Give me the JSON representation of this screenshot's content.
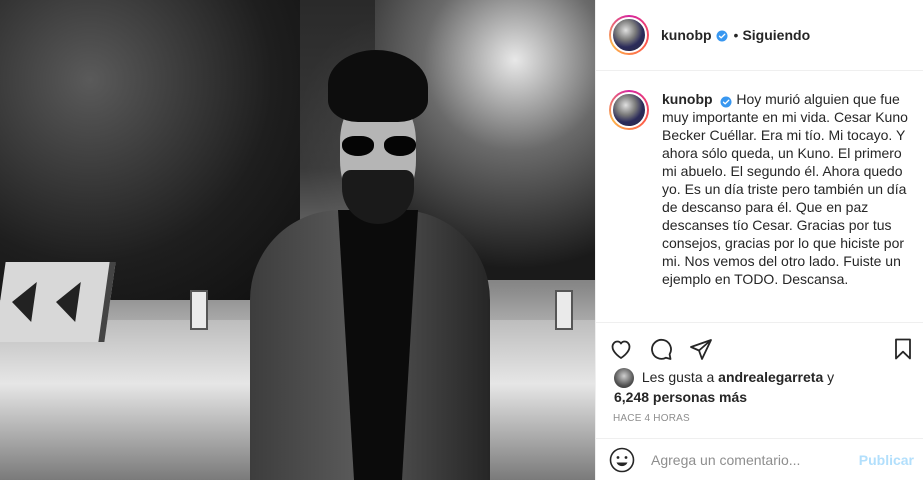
{
  "post": {
    "username": "kunobp",
    "follow_status": "Siguiendo",
    "dot": "•",
    "caption": "Hoy murió alguien que fue muy importante en mi vida. Cesar Kuno Becker Cuéllar. Era mi tío. Mi tocayo. Y ahora sólo queda, un Kuno. El primero mi abuelo. El segundo él. Ahora quedo yo. Es un día triste pero también un día de descanso para él. Que en paz descanses tío Cesar. Gracias por tus consejos, gracias por lo que hiciste por mi. Nos vemos del otro lado. Fuiste un ejemplo en TODO. Descansa.",
    "likes_prefix": "Les gusta a",
    "liked_by": "andrealegarreta",
    "likes_conjunction": "y",
    "likes_others": "6,248 personas más",
    "timestamp": "HACE 4 HORAS"
  },
  "comment": {
    "placeholder": "Agrega un comentario...",
    "publish_label": "Publicar"
  },
  "icons": {
    "verified": "verified-badge-icon",
    "like": "heart-icon",
    "comment": "comment-bubble-icon",
    "share": "paper-plane-icon",
    "save": "bookmark-icon",
    "emoji": "smiley-icon"
  },
  "colors": {
    "verified_blue": "#3897f0",
    "publish_disabled": "#b2dffc",
    "muted_text": "#8e8e8e",
    "text": "#262626"
  }
}
